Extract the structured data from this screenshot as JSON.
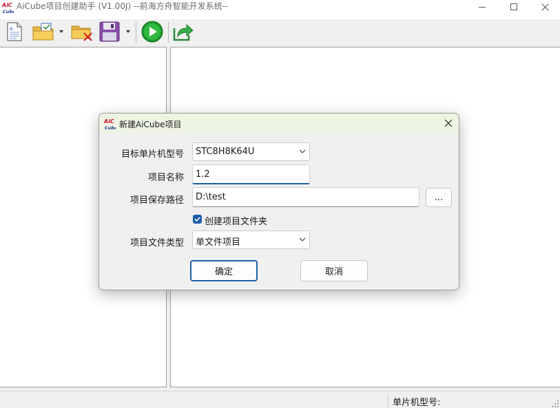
{
  "window": {
    "title": "AiCube项目创建助手 (V1.00J) --前海方舟智能开发系统--",
    "logo_text_top": "AiC",
    "logo_text_bottom": "Cube"
  },
  "toolbar": {
    "icons": [
      "new-document-icon",
      "open-folder-icon",
      "delete-folder-icon",
      "save-icon",
      "run-icon",
      "export-icon"
    ]
  },
  "status": {
    "mcu_label": "单片机型号:"
  },
  "dialog": {
    "title": "新建AiCube项目",
    "mcu_model_label": "目标单片机型号",
    "mcu_model_value": "STC8H8K64U",
    "project_name_label": "项目名称",
    "project_name_value": "1.2",
    "save_path_label": "项目保存路径",
    "save_path_value": "D:\\test",
    "browse_label": "...",
    "create_folder_label": "创建项目文件夹",
    "create_folder_checked": true,
    "file_type_label": "项目文件类型",
    "file_type_value": "单文件项目",
    "ok_label": "确定",
    "cancel_label": "取消"
  },
  "colors": {
    "accent": "#1c5fa8",
    "dialog_title_bg": "#eef4e2",
    "logo_red": "#c8102e",
    "logo_blue": "#1b3a8c"
  }
}
